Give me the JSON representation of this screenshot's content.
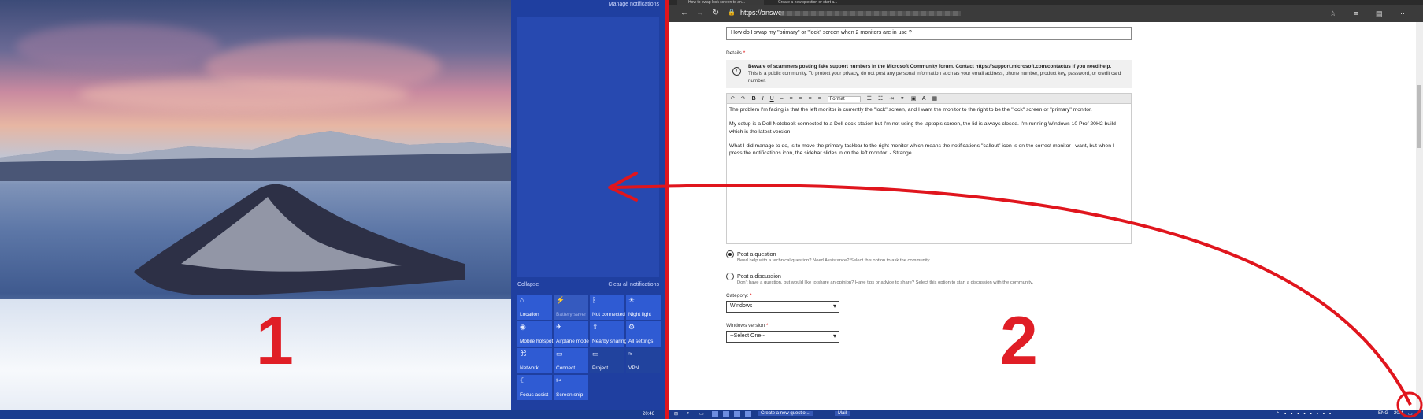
{
  "monitor1": {
    "label": "1",
    "taskbar_time": "20:46"
  },
  "action_center": {
    "manage": "Manage notifications",
    "collapse": "Collapse",
    "clear_all": "Clear all notifications",
    "tiles": [
      {
        "label": "Location",
        "icon": "location-icon",
        "glyph": "⌂",
        "state": "on"
      },
      {
        "label": "Battery saver",
        "icon": "battery-icon",
        "glyph": "⚡",
        "state": "dim"
      },
      {
        "label": "Not connected",
        "icon": "bluetooth-icon",
        "glyph": "ᛒ",
        "state": "on"
      },
      {
        "label": "Night light",
        "icon": "brightness-icon",
        "glyph": "☀",
        "state": "on"
      },
      {
        "label": "Mobile hotspot",
        "icon": "hotspot-icon",
        "glyph": "◉",
        "state": "on"
      },
      {
        "label": "Airplane mode",
        "icon": "airplane-icon",
        "glyph": "✈",
        "state": "on"
      },
      {
        "label": "Nearby sharing",
        "icon": "share-icon",
        "glyph": "⇪",
        "state": "on"
      },
      {
        "label": "All settings",
        "icon": "gear-icon",
        "glyph": "⚙",
        "state": "on"
      },
      {
        "label": "Network",
        "icon": "network-icon",
        "glyph": "⌘",
        "state": "on"
      },
      {
        "label": "Connect",
        "icon": "connect-icon",
        "glyph": "▭",
        "state": "on"
      },
      {
        "label": "Project",
        "icon": "project-icon",
        "glyph": "▭",
        "state": "dark"
      },
      {
        "label": "VPN",
        "icon": "vpn-icon",
        "glyph": "≈",
        "state": "dark"
      },
      {
        "label": "Focus assist",
        "icon": "moon-icon",
        "glyph": "☾",
        "state": "on"
      },
      {
        "label": "Screen snip",
        "icon": "scissors-icon",
        "glyph": "✂",
        "state": "on"
      }
    ]
  },
  "browser": {
    "tabs": [
      "How to swap lock screen to an...",
      "Create a new question or start a..."
    ],
    "url": "https://answer",
    "page": {
      "title_value": "How do I swap my \"primary\" or \"lock\" screen when 2 monitors are in use ?",
      "details_label": "Details",
      "required_mark": "*",
      "warning_bold": "Beware of scammers posting fake support numbers in the Microsoft Community forum. Contact https://support.microsoft.com/contactus if you need help.",
      "warning_text": "This is a public community. To protect your privacy, do not post any personal information such as your email address, phone number, product key, password, or credit card number.",
      "format_label": "Format",
      "body": [
        "The problem I'm facing is that the left monitor is currently the \"lock\" screen, and I want the monitor to the right to be the \"lock\" screen or \"primary\" monitor.",
        "My setup is a Dell Notebook connected to a Dell dock station but I'm not using the laptop's screen, the lid is always closed. I'm running Windows 10 Prof 20H2 build which is the latest version.",
        "What I did manage to do, is to move the primary taskbar to the right monitor which means the notifications \"callout\" icon is on the correct monitor I want, but when I press the notifications icon, the sidebar slides in on the left monitor. - Strange."
      ],
      "post_question_label": "Post a question",
      "post_question_desc": "Need help with a technical question? Need Assistance? Select this option to ask the community.",
      "post_discussion_label": "Post a discussion",
      "post_discussion_desc": "Don't have a question, but would like to share an opinion? Have tips or advice to share? Select this option to start a discussion with the community.",
      "category_label": "Category:",
      "category_value": "Windows",
      "version_label": "Windows version",
      "version_value": "--Select One--"
    }
  },
  "monitor2": {
    "label": "2",
    "taskbar_items": [
      "Create a new questio...",
      "Mail"
    ],
    "taskbar_lang": "ENG",
    "taskbar_time": "20:4"
  },
  "colors": {
    "annotation_red": "#e0151d",
    "action_center_blue": "#1f3fa0",
    "tile_blue": "#2f5bd3"
  }
}
